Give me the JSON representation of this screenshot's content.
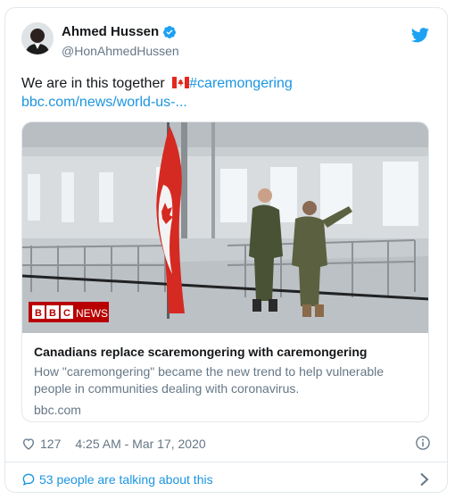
{
  "author": {
    "display_name": "Ahmed Hussen",
    "handle": "@HonAhmedHussen",
    "verified": true
  },
  "tweet": {
    "text_before": "We are in this together",
    "flag_emoji": "canada-flag-icon",
    "hashtag": "#caremongering",
    "link": "bbc.com/news/world-us-..."
  },
  "card": {
    "badge": "BBC",
    "badge_news": "NEWS",
    "title": "Canadians replace scaremongering with caremongering",
    "description": "How \"caremongering\" became the new trend to help vulnerable people in communities dealing with coronavirus.",
    "domain": "bbc.com"
  },
  "meta": {
    "likes": "127",
    "timestamp": "4:25 AM - Mar 17, 2020"
  },
  "footer": {
    "talking": "53 people are talking about this"
  },
  "colors": {
    "accent": "#1da1f2",
    "link": "#1b95e0",
    "secondary_text": "#657786",
    "bbc_red": "#b80000"
  }
}
